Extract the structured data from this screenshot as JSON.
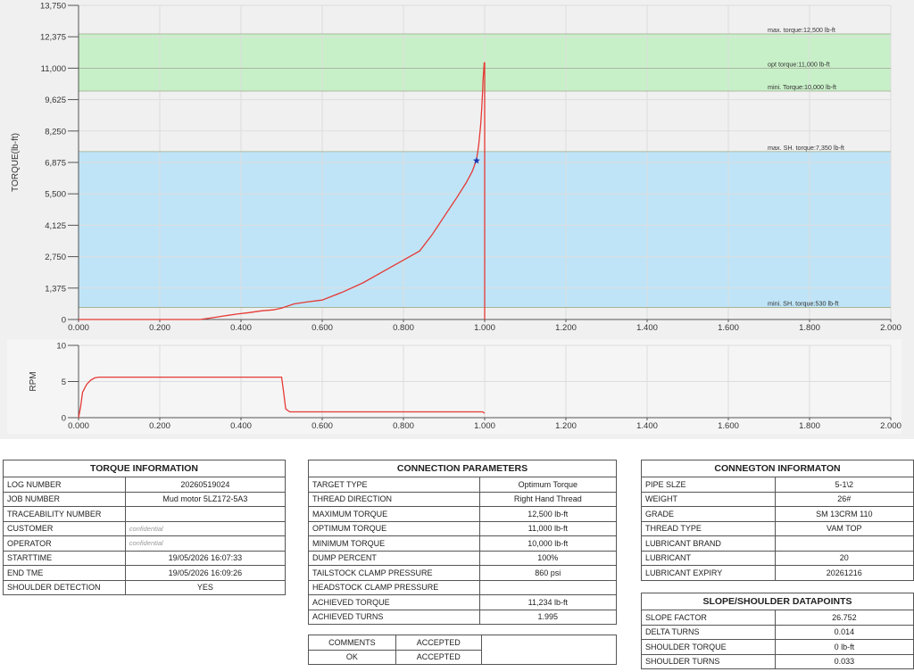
{
  "chart_data": [
    {
      "type": "line",
      "title": "",
      "xlabel": "",
      "ylabel": "TORQUE(lb-ft)",
      "xlim": [
        0,
        2
      ],
      "ylim": [
        0,
        13750
      ],
      "grid": true,
      "x_ticks": [
        "0.000",
        "0.200",
        "0.400",
        "0.600",
        "0.800",
        "1.000",
        "1.200",
        "1.400",
        "1.600",
        "1.800",
        "2.000"
      ],
      "y_ticks": [
        "0",
        "1,375",
        "2,750",
        "4,125",
        "5,500",
        "6,875",
        "8,250",
        "9,625",
        "11,000",
        "12,375",
        "13,750"
      ],
      "bands": [
        {
          "from": 530,
          "to": 7350,
          "color": "#bfe4f7"
        },
        {
          "from": 10000,
          "to": 12500,
          "color": "#c8f0c8"
        }
      ],
      "reference_lines": [
        {
          "y": 12500,
          "label": "max. torque:12,500 lb-ft"
        },
        {
          "y": 11000,
          "label": "opt torque:11,000 lb-ft"
        },
        {
          "y": 10000,
          "label": "mini. Torque:10,000 lb-ft"
        },
        {
          "y": 7350,
          "label": "max. SH. torque:7,350 lb-ft"
        },
        {
          "y": 530,
          "label": "mini. SH. torque:530 lb-ft"
        }
      ],
      "series": [
        {
          "color": "#e53935",
          "x": [
            0,
            0.1,
            0.2,
            0.3,
            0.33,
            0.36,
            0.39,
            0.42,
            0.45,
            0.48,
            0.5,
            0.53,
            0.56,
            0.6,
            0.65,
            0.7,
            0.75,
            0.8,
            0.84,
            0.87,
            0.9,
            0.93,
            0.955,
            0.97,
            0.98,
            0.985,
            0.99,
            0.993,
            0.995,
            0.996,
            0.998,
            0.999,
            1.0,
            1.0
          ],
          "y": [
            0,
            0,
            0,
            0,
            80,
            160,
            240,
            300,
            380,
            420,
            500,
            680,
            760,
            850,
            1200,
            1600,
            2100,
            2600,
            3000,
            3700,
            4500,
            5300,
            6000,
            6500,
            7000,
            7600,
            8500,
            9300,
            10000,
            10500,
            11000,
            11234,
            11234,
            0
          ]
        }
      ],
      "markers": [
        {
          "x": 0.98,
          "y": 6950,
          "shape": "star",
          "color": "#1a35b0"
        }
      ]
    },
    {
      "type": "line",
      "title": "",
      "xlabel": "",
      "ylabel": "RPM",
      "xlim": [
        0,
        2
      ],
      "ylim": [
        0,
        10
      ],
      "grid": true,
      "x_ticks": [
        "0.000",
        "0.200",
        "0.400",
        "0.600",
        "0.800",
        "1.000",
        "1.200",
        "1.400",
        "1.600",
        "1.800",
        "2.000"
      ],
      "y_ticks": [
        "0",
        "5",
        "10"
      ],
      "series": [
        {
          "color": "#e53935",
          "x": [
            0,
            0.005,
            0.01,
            0.02,
            0.03,
            0.04,
            0.05,
            0.1,
            0.2,
            0.3,
            0.4,
            0.5,
            0.505,
            0.51,
            0.52,
            0.6,
            0.7,
            0.8,
            0.9,
            0.995,
            1.0
          ],
          "y": [
            0,
            1.5,
            3.5,
            4.6,
            5.2,
            5.5,
            5.6,
            5.6,
            5.6,
            5.6,
            5.6,
            5.6,
            3.5,
            1.2,
            0.8,
            0.8,
            0.8,
            0.8,
            0.8,
            0.8,
            0.6
          ]
        }
      ]
    }
  ],
  "tables": {
    "torque_info": {
      "title": "TORQUE INFORMATION",
      "rows": [
        {
          "label": "LOG NUMBER",
          "value": "20260519024"
        },
        {
          "label": "JOB NUMBER",
          "value": "Mud motor 5LZ172-5A3"
        },
        {
          "label": "TRACEABILITY NUMBER",
          "value": ""
        },
        {
          "label": "CUSTOMER",
          "value": "confidential"
        },
        {
          "label": "OPERATOR",
          "value": "confidential"
        },
        {
          "label": "STARTTIME",
          "value": "19/05/2026 16:07:33"
        },
        {
          "label": "END TME",
          "value": "19/05/2026 16:09:26"
        },
        {
          "label": "SHOULDER DETECTION",
          "value": "YES"
        }
      ]
    },
    "connection_params": {
      "title": "CONNECTION PARAMETERS",
      "rows": [
        {
          "label": "TARGET TYPE",
          "value": "Optimum Torque"
        },
        {
          "label": "THREAD DIRECTION",
          "value": "Right Hand Thread"
        },
        {
          "label": "MAXIMUM TORQUE",
          "value": "12,500 lb-ft"
        },
        {
          "label": "OPTIMUM TORQUE",
          "value": "11,000 lb-ft"
        },
        {
          "label": "MINIMUM TORQUE",
          "value": "10,000 lb-ft"
        },
        {
          "label": "DUMP PERCENT",
          "value": "100%"
        },
        {
          "label": "TAILSTOCK CLAMP PRESSURE",
          "value": "860 psi"
        },
        {
          "label": "HEADSTOCK CLAMP PRESSURE",
          "value": ""
        },
        {
          "label": "ACHIEVED TORQUE",
          "value": "11,234 lb-ft"
        },
        {
          "label": "ACHIEVED TURNS",
          "value": "1.995"
        }
      ]
    },
    "connection_info": {
      "title": "CONNEGTON INFORMATON",
      "rows": [
        {
          "label": "PIPE SLZE",
          "value": "5-1\\2"
        },
        {
          "label": "WEIGHT",
          "value": "26#"
        },
        {
          "label": "GRADE",
          "value": "SM 13CRM 110"
        },
        {
          "label": "THREAD TYPE",
          "value": "VAM TOP"
        },
        {
          "label": "LUBRICANT BRAND",
          "value": ""
        },
        {
          "label": "LUBRICANT",
          "value": "20"
        },
        {
          "label": "LUBRICANT EXPIRY",
          "value": "20261216"
        }
      ]
    },
    "slope_shoulder": {
      "title": "SLOPE/SHOULDER DATAPOINTS",
      "rows": [
        {
          "label": "SLOPE FACTOR",
          "value": "26.752"
        },
        {
          "label": "DELTA TURNS",
          "value": "0.014"
        },
        {
          "label": "SHOULDER TORQUE",
          "value": "0 lb-ft"
        },
        {
          "label": "SHOULDER TURNS",
          "value": "0.033"
        }
      ]
    },
    "comments": {
      "rows": [
        {
          "label": "COMMENTS",
          "value": "ACCEPTED"
        },
        {
          "label": "OK",
          "value": "ACCEPTED"
        }
      ]
    }
  }
}
